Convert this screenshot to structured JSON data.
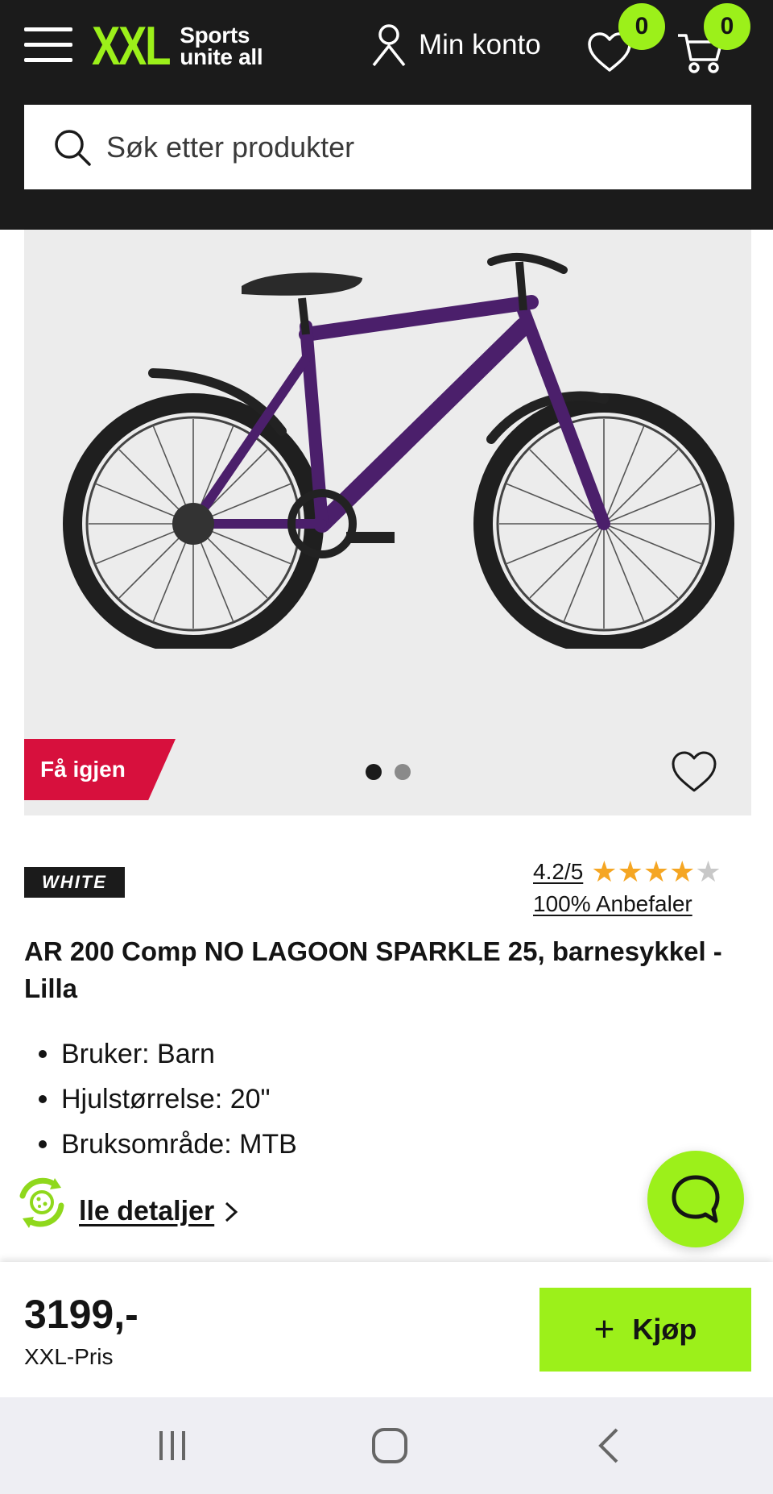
{
  "header": {
    "logo_mark": "XXL",
    "logo_tagline_line1": "Sports",
    "logo_tagline_line2": "unite all",
    "account_label": "Min konto",
    "wishlist_count": "0",
    "cart_count": "0"
  },
  "search": {
    "placeholder": "Søk etter produkter"
  },
  "gallery": {
    "promo_label": "Få igjen",
    "image_count": 2,
    "active_index": 1
  },
  "product": {
    "brand": "WHITE",
    "rating_text": "4.2/5",
    "rating_value": 4.2,
    "rating_max": 5,
    "recommend_text": "100% Anbefaler",
    "title": "AR 200 Comp NO LAGOON SPARKLE 25, barnesykkel - Lilla",
    "specs": [
      "Bruker: Barn",
      "Hjulstørrelse: 20\"",
      "Bruksområde: MTB"
    ],
    "details_link": "lle detaljer"
  },
  "buybar": {
    "price": "3199,-",
    "price_label": "XXL-Pris",
    "buy_label": "Kjøp"
  },
  "colors": {
    "brand_green": "#9cf01a",
    "header_bg": "#1b1b1b",
    "promo_red": "#d7103d",
    "star_color": "#f5a623"
  },
  "icons": [
    "menu-icon",
    "user-icon",
    "heart-icon",
    "cart-icon",
    "search-icon",
    "chat-icon",
    "cookie-icon",
    "chevron-right-icon"
  ]
}
